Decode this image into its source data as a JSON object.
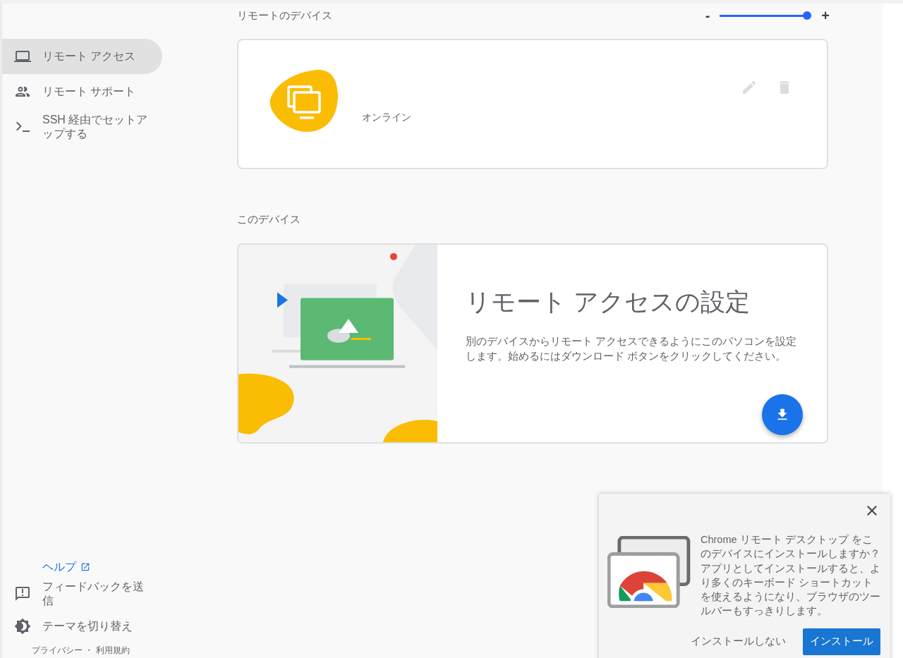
{
  "sidebar": {
    "items": [
      {
        "kind": "laptop",
        "label": "リモート アクセス",
        "selected": true
      },
      {
        "kind": "people",
        "label": "リモート サポート",
        "selected": false
      },
      {
        "kind": "terminal",
        "label": "SSH 経由でセットアップする",
        "selected": false
      }
    ],
    "help_link": "ヘルプ",
    "bottom_items": [
      {
        "kind": "feedback",
        "label": "フィードバックを送信"
      },
      {
        "kind": "theme",
        "label": "テーマを切り替え"
      }
    ],
    "footer": "プライバシー ・ 利用規約"
  },
  "remote_devices": {
    "heading": "リモートのデバイス",
    "zoom": {
      "minus": "-",
      "plus": "+",
      "level": 1
    },
    "devices": [
      {
        "status": "オンライン"
      }
    ]
  },
  "this_device": {
    "heading": "このデバイス",
    "title": "リモート アクセスの設定",
    "description": "別のデバイスからリモート アクセスできるようにこのパソコンを設定します。始めるにはダウンロード ボタンをクリックしてください。"
  },
  "install_prompt": {
    "message": "Chrome リモート デスクトップ をこのデバイスにインストールしますか？アプリとしてインストールすると、より多くのキーボード ショートカットを使えるようになり、ブラウザのツールバーもすっきりします。",
    "buttons": [
      {
        "kind": "text",
        "label": "インストールしない"
      },
      {
        "kind": "primary",
        "label": "インストール"
      }
    ]
  }
}
